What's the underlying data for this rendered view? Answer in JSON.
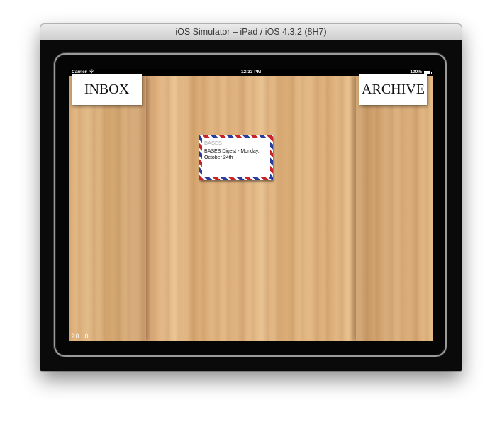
{
  "window": {
    "title": "iOS Simulator – iPad / iOS 4.3.2 (8H7)"
  },
  "status_bar": {
    "carrier": "Carrier",
    "wifi_icon": "wifi-icon",
    "time": "12:33 PM",
    "battery": "100%",
    "battery_icon": "battery-icon"
  },
  "bins": {
    "inbox_label": "INBOX",
    "archive_label": "ARCHIVE"
  },
  "message": {
    "sender": "BASES",
    "subject": "BASES Digest - Monday, October 24th"
  },
  "version": "20.0",
  "colors": {
    "airmail_red": "#c8232c",
    "airmail_blue": "#2a3d9e",
    "wood": "#dcae78"
  }
}
